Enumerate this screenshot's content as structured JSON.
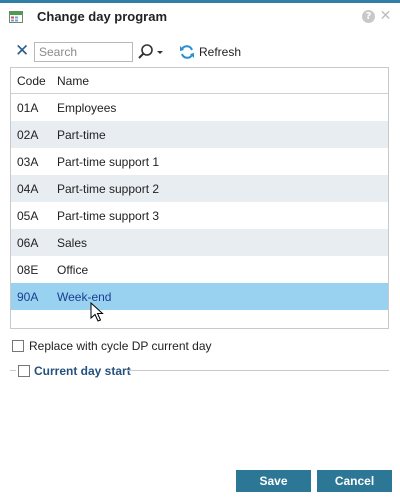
{
  "dialog": {
    "title": "Change day program"
  },
  "toolbar": {
    "search_placeholder": "Search",
    "search_value": "",
    "refresh_label": "Refresh"
  },
  "grid": {
    "columns": [
      "Code",
      "Name"
    ],
    "rows": [
      {
        "code": "01A",
        "name": "Employees"
      },
      {
        "code": "02A",
        "name": "Part-time"
      },
      {
        "code": "03A",
        "name": "Part-time support 1"
      },
      {
        "code": "04A",
        "name": "Part-time support 2"
      },
      {
        "code": "05A",
        "name": "Part-time support 3"
      },
      {
        "code": "06A",
        "name": "Sales"
      },
      {
        "code": "08E",
        "name": "Office"
      },
      {
        "code": "90A",
        "name": "Week-end"
      }
    ],
    "selected_code": "90A"
  },
  "options": {
    "replace_label": "Replace with cycle DP current day",
    "replace_checked": false,
    "current_day_start_label": "Current day start",
    "current_day_start_checked": false
  },
  "buttons": {
    "save": "Save",
    "cancel": "Cancel"
  },
  "colors": {
    "accent": "#2d7796",
    "selected_row": "#99d1f1",
    "alt_row": "#e8edf2",
    "legend_text": "#24527e"
  },
  "icons": {
    "app": "calendar-icon",
    "help": "help-icon",
    "close": "close-icon",
    "clear": "clear-icon",
    "search": "magnifier-icon",
    "refresh": "refresh-icon"
  }
}
